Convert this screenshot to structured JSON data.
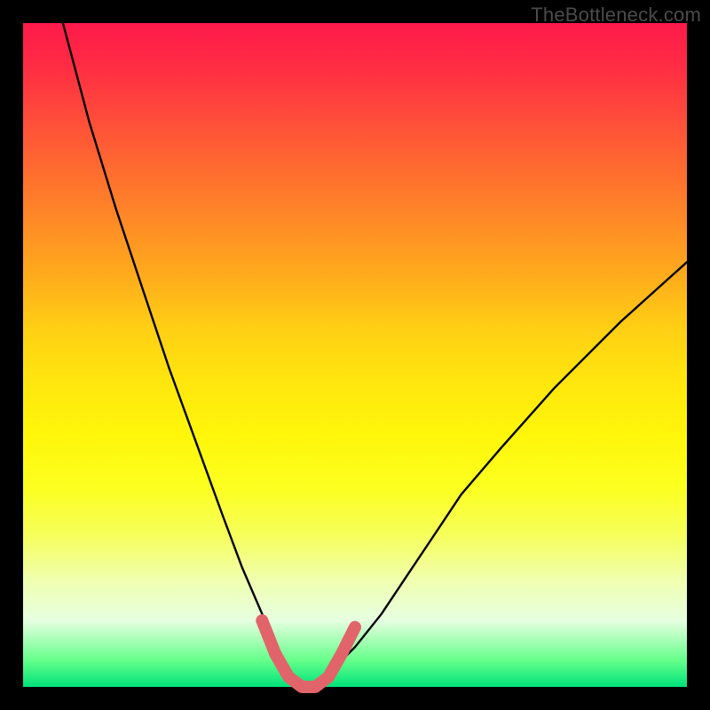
{
  "watermark": "TheBottleneck.com",
  "chart_data": {
    "type": "line",
    "title": "",
    "xlabel": "",
    "ylabel": "",
    "xlim": [
      0,
      100
    ],
    "ylim": [
      0,
      100
    ],
    "grid": false,
    "legend": false,
    "series": [
      {
        "name": "bottleneck-curve",
        "color": "#000000",
        "x": [
          6,
          10,
          14,
          18,
          22,
          26,
          30,
          33,
          36,
          38,
          40,
          42,
          44,
          46,
          50,
          54,
          58,
          62,
          66,
          72,
          80,
          90,
          100
        ],
        "y": [
          100,
          85,
          72,
          60,
          48,
          37,
          26,
          18,
          11,
          6,
          2,
          0,
          0,
          2,
          6,
          11,
          17,
          23,
          29,
          36,
          45,
          55,
          64
        ]
      },
      {
        "name": "optimal-zone-highlight",
        "color": "#e2646b",
        "x": [
          36,
          38,
          40,
          42,
          44,
          46,
          48,
          50
        ],
        "y": [
          10,
          5,
          1.5,
          0,
          0,
          1.5,
          5,
          9
        ]
      }
    ],
    "annotations": []
  },
  "colors": {
    "frame": "#000000",
    "gradient_top": "#ff1a4b",
    "gradient_mid": "#ffe60e",
    "gradient_bottom": "#00e27a",
    "curve": "#000000",
    "highlight": "#e2646b"
  }
}
